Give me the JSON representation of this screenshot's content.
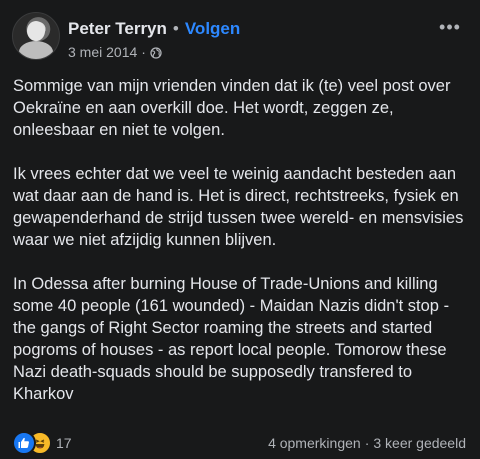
{
  "header": {
    "name": "Peter Terryn",
    "separator": "•",
    "follow_label": "Volgen",
    "date": "3 mei 2014",
    "meta_separator": "·",
    "privacy_icon": "globe-icon",
    "more_icon": "more-horizontal-icon",
    "more_label": "•••"
  },
  "post": {
    "paragraphs": [
      "Sommige van mijn vrienden vinden dat ik (te) veel post over Oekraïne en aan overkill doe. Het wordt, zeggen ze, onleesbaar en niet te volgen.",
      "Ik vrees echter dat we veel te weinig aandacht besteden aan wat daar aan de hand is. Het is direct, rechtstreeks, fysiek en gewapenderhand de strijd tussen twee wereld- en mensvisies waar we niet afzijdig kunnen blijven.",
      "In Odessa after burning House of Trade-Unions and killing some 40 people (161 wounded) - Maidan Nazis didn't stop - the gangs of Right Sector roaming the streets and started pogroms of houses - as report local people. Tomorow these Nazi death-squads should be supposedly transfered to Kharkov"
    ]
  },
  "footer": {
    "reaction_icons": [
      "like-icon",
      "haha-icon"
    ],
    "reaction_count": "17",
    "comments": "4 opmerkingen",
    "stats_separator": "·",
    "shares": "3 keer gedeeld"
  },
  "colors": {
    "background": "#18191a",
    "text": "#e4e6eb",
    "secondary": "#b0b3b8",
    "link": "#2d88ff",
    "like": "#1877f2",
    "haha": "#f7b928"
  }
}
